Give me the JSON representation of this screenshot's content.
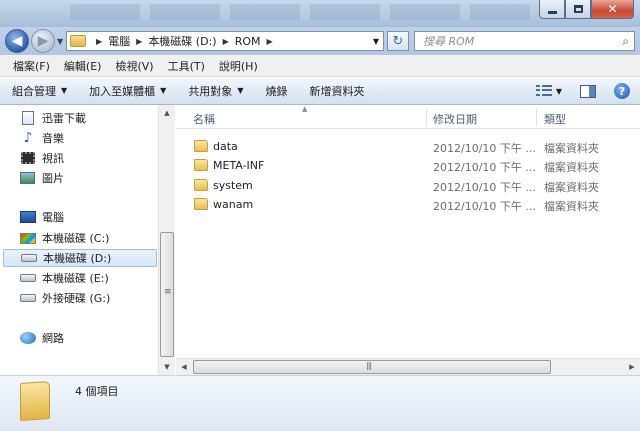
{
  "address": {
    "breadcrumbs": [
      "電腦",
      "本機磁碟 (D:)",
      "ROM"
    ]
  },
  "search": {
    "placeholder": "搜尋 ROM"
  },
  "menu": [
    "檔案(F)",
    "編輯(E)",
    "檢視(V)",
    "工具(T)",
    "說明(H)"
  ],
  "toolbar": {
    "organize": "組合管理",
    "add_to_library": "加入至媒體櫃",
    "share_with": "共用對象",
    "burn": "燒錄",
    "new_folder": "新增資料夾"
  },
  "sidebar": {
    "libraries": [
      {
        "label": "迅雷下載",
        "icon": "document-icon"
      },
      {
        "label": "音樂",
        "icon": "music-icon"
      },
      {
        "label": "視訊",
        "icon": "video-icon"
      },
      {
        "label": "圖片",
        "icon": "picture-icon"
      }
    ],
    "computer": "電腦",
    "drives": [
      {
        "label": "本機磁碟 (C:)",
        "icon": "system-drive-icon"
      },
      {
        "label": "本機磁碟 (D:)",
        "icon": "drive-icon",
        "selected": true
      },
      {
        "label": "本機磁碟 (E:)",
        "icon": "drive-icon"
      },
      {
        "label": "外接硬碟 (G:)",
        "icon": "drive-icon"
      }
    ],
    "network": "網路"
  },
  "columns": {
    "name": "名稱",
    "date": "修改日期",
    "type": "類型"
  },
  "files": [
    {
      "name": "data",
      "date": "2012/10/10 下午 ...",
      "type": "檔案資料夾"
    },
    {
      "name": "META-INF",
      "date": "2012/10/10 下午 ...",
      "type": "檔案資料夾"
    },
    {
      "name": "system",
      "date": "2012/10/10 下午 ...",
      "type": "檔案資料夾"
    },
    {
      "name": "wanam",
      "date": "2012/10/10 下午 ...",
      "type": "檔案資料夾"
    }
  ],
  "status": {
    "item_count": "4 個項目"
  },
  "colors": {
    "accent": "#2c5ea8",
    "folder": "#e8bf55",
    "selection": "#d5e6f8"
  }
}
